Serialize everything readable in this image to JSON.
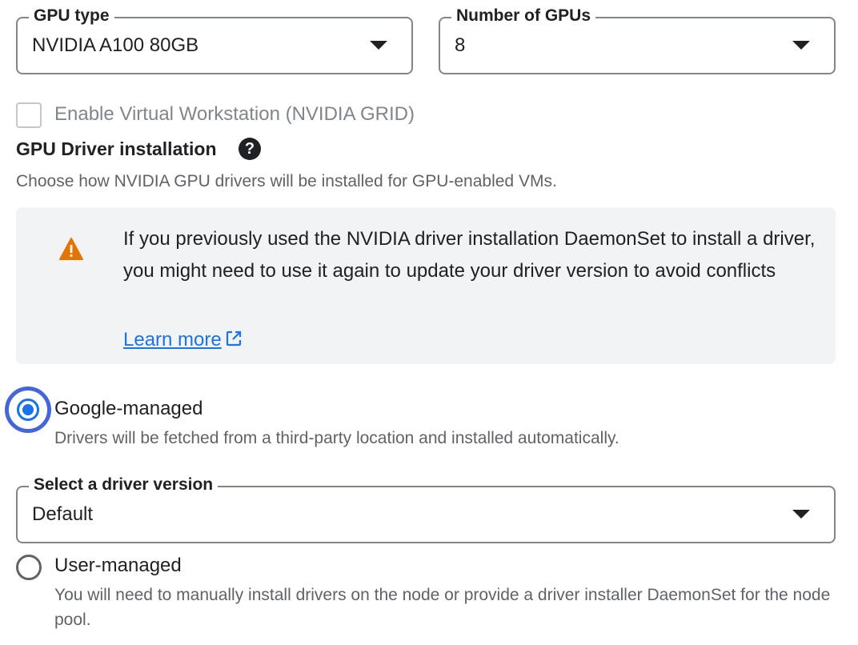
{
  "gpu_type": {
    "label": "GPU type",
    "value": "NVIDIA A100 80GB"
  },
  "gpu_count": {
    "label": "Number of GPUs",
    "value": "8"
  },
  "virtual_workstation": {
    "label": "Enable Virtual Workstation (NVIDIA GRID)",
    "checked": false,
    "disabled": true
  },
  "driver_section": {
    "heading": "GPU Driver installation",
    "help_icon": "help-circle-icon",
    "help_glyph": "?",
    "description": "Choose how NVIDIA GPU drivers will be installed for GPU-enabled VMs."
  },
  "warning": {
    "icon": "warning-triangle-icon",
    "text": "If you previously used the NVIDIA driver installation DaemonSet to install a driver, you might need to use it again to update your driver version to avoid conflicts",
    "link_label": "Learn more",
    "link_icon": "external-link-icon",
    "icon_color": "#e37400",
    "link_color": "#1a73e8"
  },
  "options": {
    "google_managed": {
      "label": "Google-managed",
      "description": "Drivers will be fetched from a third-party location and installed automatically.",
      "selected": true
    },
    "driver_version": {
      "label": "Select a driver version",
      "value": "Default"
    },
    "user_managed": {
      "label": "User-managed",
      "description": "You will need to manually install drivers on the node or provide a driver installer DaemonSet for the node pool.",
      "selected": false
    }
  },
  "colors": {
    "accent": "#1a73e8",
    "focus_ring": "#4566d8",
    "muted_text": "#5f6368"
  }
}
